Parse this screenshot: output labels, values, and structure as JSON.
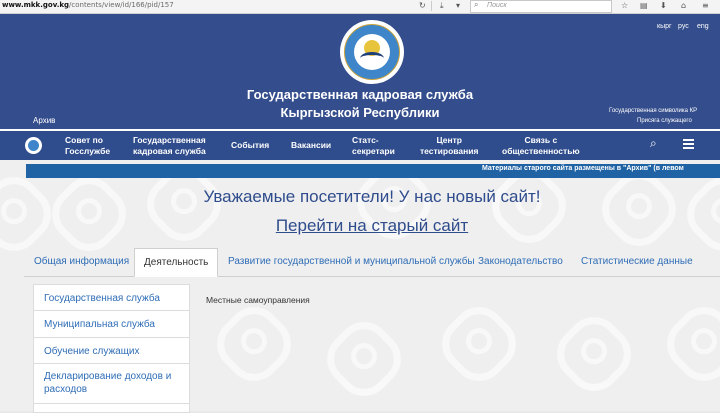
{
  "browser": {
    "url_domain": "www.mkk.gov.kg",
    "url_path": "/contents/view/id/166/pid/157",
    "search_placeholder": "Поиск"
  },
  "header": {
    "title_line1": "Государственная кадровая служба",
    "title_line2": "Кыргызской Республики",
    "archive": "Архив",
    "languages": [
      "кырг",
      "рус",
      "eng"
    ],
    "symbolics": "Государственная символика КР",
    "oath": "Присяга служащего"
  },
  "nav": {
    "items": [
      "Совет по\nГосслужбе",
      "Государственная\nкадровая служба",
      "События",
      "Вакансии",
      "Статс-\nсекретари",
      "Центр\nтестирования",
      "Связь с\nобщественностью"
    ]
  },
  "notice": "Материалы старого сайта размещены в \"Архив\" (в левом ",
  "greeting": "Уважаемые посетители! У нас новый сайт!",
  "old_site_link": "Перейти на старый сайт",
  "tabs": [
    "Общая информация",
    "Деятельность",
    "Развитие государственной и муниципальной службы",
    "Законодательство",
    "Статистические данные"
  ],
  "side_menu": [
    "Государственная служба",
    "Муниципальная служба",
    "Обучение служащих",
    "Декларирование доходов и\nрасходов"
  ],
  "main_text": "Местные самоуправления",
  "colors": {
    "header_bg": "#344d8c",
    "nav_bg": "#2f4c8c",
    "notice_bg": "#1f63a5",
    "link": "#2f6db6"
  }
}
